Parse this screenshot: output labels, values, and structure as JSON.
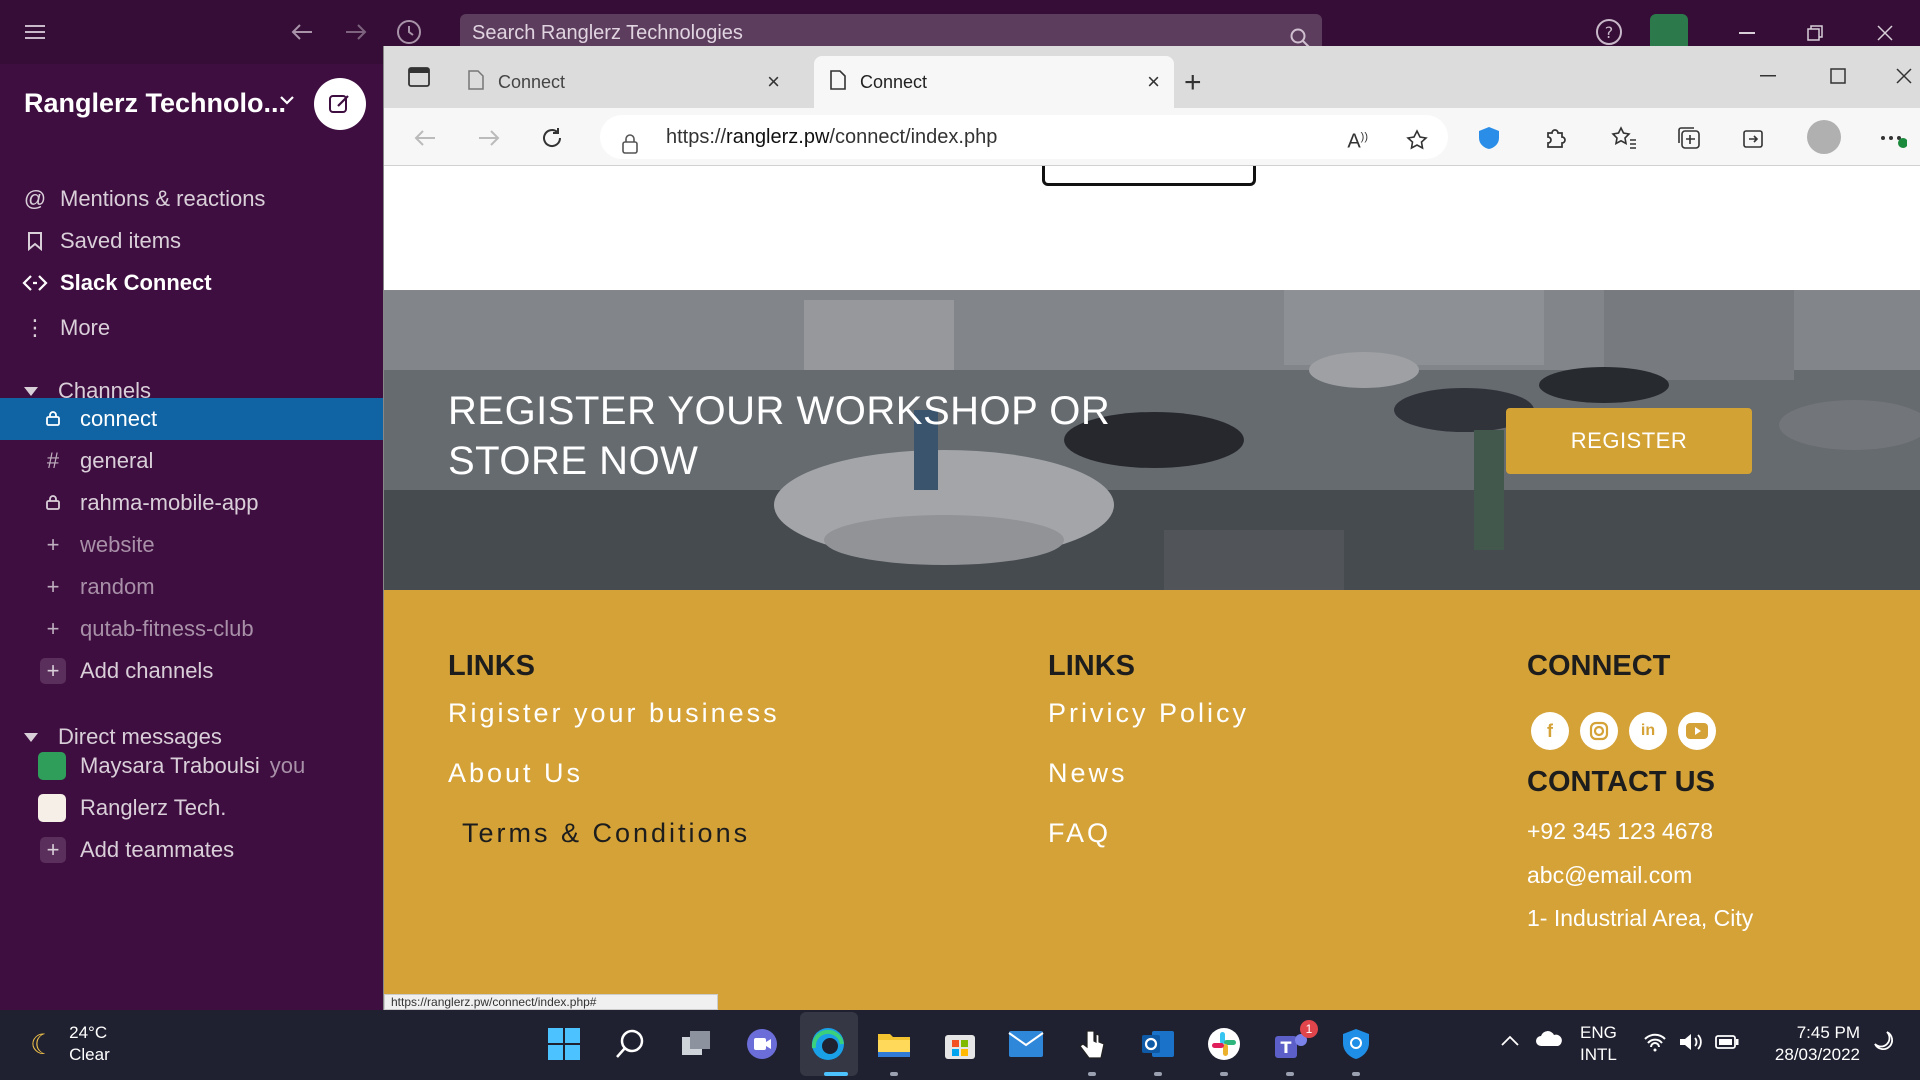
{
  "slack": {
    "search_placeholder": "Search Ranglerz Technologies",
    "workspace_name": "Ranglerz Technolo...",
    "nav": [
      {
        "label": "Mentions & reactions",
        "icon": "at-icon"
      },
      {
        "label": "Saved items",
        "icon": "bookmark-icon"
      },
      {
        "label": "Slack Connect",
        "icon": "slack-connect-icon"
      },
      {
        "label": "More",
        "icon": "more-vertical-icon"
      }
    ],
    "channels_header": "Channels",
    "channels": [
      {
        "name": "connect",
        "icon": "lock-icon",
        "active": true
      },
      {
        "name": "general",
        "icon": "hash-icon"
      },
      {
        "name": "rahma-mobile-app",
        "icon": "lock-icon"
      },
      {
        "name": "website",
        "icon": "plus-icon",
        "dim": true
      },
      {
        "name": "random",
        "icon": "plus-icon",
        "dim": true
      },
      {
        "name": "qutab-fitness-club",
        "icon": "plus-icon",
        "dim": true
      }
    ],
    "add_channels": "Add channels",
    "dm_header": "Direct messages",
    "dms": [
      {
        "name": "Maysara Traboulsi",
        "suffix": "you"
      },
      {
        "name": "Ranglerz Tech."
      }
    ],
    "add_teammates": "Add teammates"
  },
  "browser": {
    "tabs": [
      {
        "label": "Connect",
        "active": false
      },
      {
        "label": "Connect",
        "active": true
      }
    ],
    "url_prefix": "https://",
    "url_domain": "ranglerz.pw",
    "url_path": "/connect/index.php",
    "status_url": "https://ranglerz.pw/connect/index.php#"
  },
  "site": {
    "hero_title": "REGISTER YOUR WORKSHOP OR STORE NOW",
    "register_button": "REGISTER",
    "footer": {
      "col1_title": "LINKS",
      "col1_links": [
        "Rigister your business",
        "About Us",
        "Terms & Conditions"
      ],
      "col2_title": "LINKS",
      "col2_links": [
        "Privicy Policy",
        "News",
        "FAQ"
      ],
      "connect_title": "CONNECT",
      "social": [
        "facebook-icon",
        "instagram-icon",
        "linkedin-icon",
        "youtube-icon"
      ],
      "contact_title": "CONTACT US",
      "phone": "+92 345 123 4678",
      "email": "abc@email.com",
      "address": "1- Industrial Area, City"
    },
    "colors": {
      "gold": "#d4a237",
      "slack_purple": "#3f0e40",
      "slack_active": "#1164a3"
    }
  },
  "taskbar": {
    "temperature": "24°C",
    "weather": "Clear",
    "lang1": "ENG",
    "lang2": "INTL",
    "time": "7:45 PM",
    "date": "28/03/2022",
    "teams_badge": "1"
  }
}
